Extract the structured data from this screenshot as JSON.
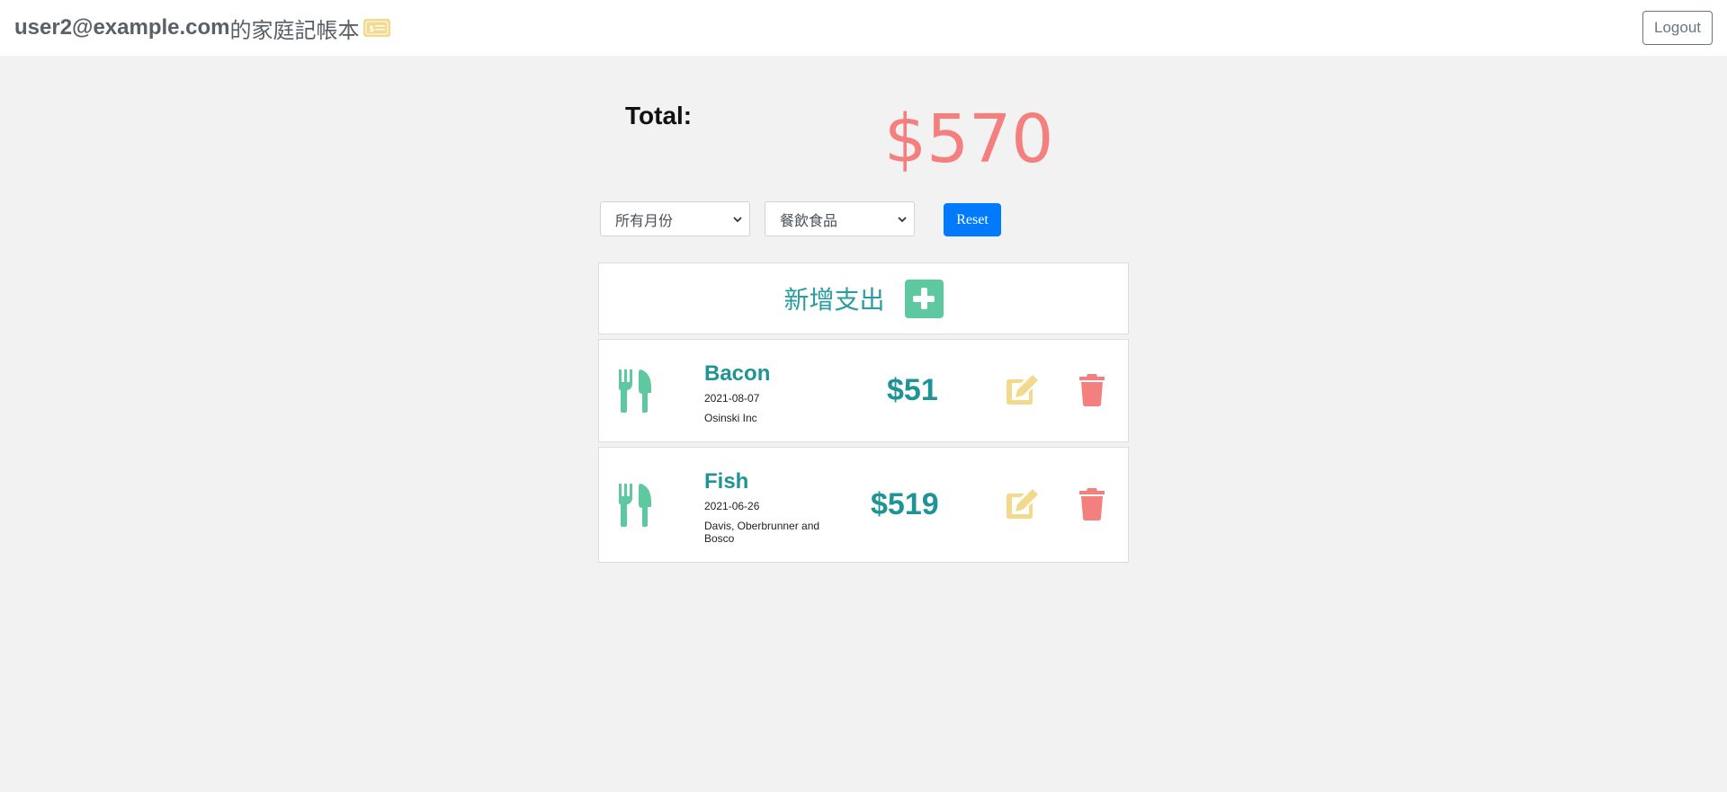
{
  "navbar": {
    "user_email": "user2@example.com",
    "app_title": "的家庭記帳本",
    "brand_icon": "money-bill-icon",
    "logout_label": "Logout"
  },
  "summary": {
    "total_label": "Total:",
    "total_amount": "$570"
  },
  "filters": {
    "month_selected": "所有月份",
    "category_selected": "餐飲食品",
    "reset_label": "Reset"
  },
  "add_expense": {
    "label": "新增支出",
    "icon": "plus-square-icon"
  },
  "records": [
    {
      "name": "Bacon",
      "date": "2021-08-07",
      "merchant": "Osinski Inc",
      "amount": "$51",
      "category_icon": "utensils-icon"
    },
    {
      "name": "Fish",
      "date": "2021-06-26",
      "merchant": "Davis, Oberbrunner and Bosco",
      "amount": "$519",
      "category_icon": "utensils-icon"
    }
  ],
  "colors": {
    "accent_teal": "#1e9496",
    "add_green": "#5ec9a0",
    "total_red": "#f47f7f",
    "edit_yellow": "#f3d98b",
    "trash_red": "#f47f7f",
    "primary_blue": "#007bff",
    "background": "#f2f2f2"
  }
}
